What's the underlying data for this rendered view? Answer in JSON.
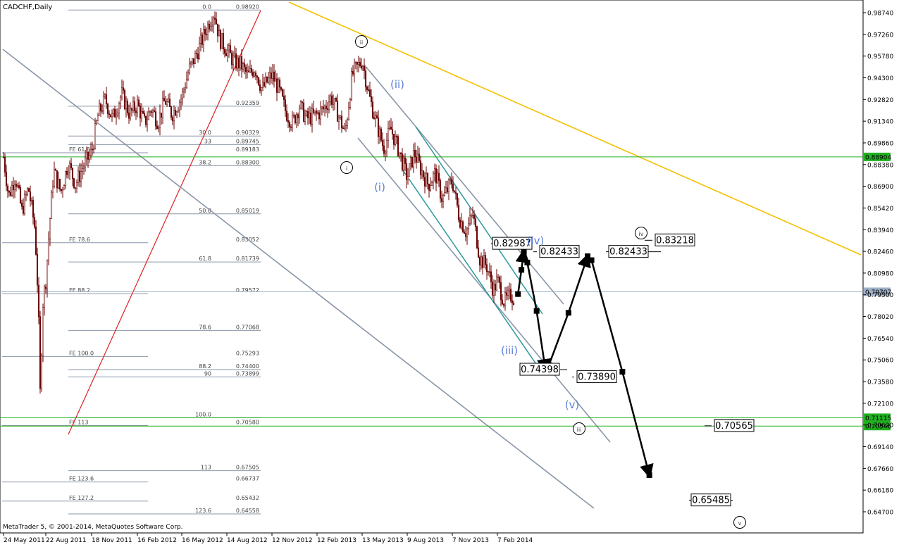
{
  "header": {
    "symbol": "CADCHF,Daily"
  },
  "footer": {
    "copyright": "MetaTrader 5, © 2001-2014, MetaQuotes Software Corp."
  },
  "chart_data": {
    "type": "candlestick",
    "title": "CADCHF,Daily",
    "ylim": [
      0.6442,
      0.9934
    ],
    "y_ticks": [
      "0.98740",
      "0.97260",
      "0.95780",
      "0.94300",
      "0.92820",
      "0.91340",
      "0.89860",
      "0.88380",
      "0.86900",
      "0.85420",
      "0.83940",
      "0.82460",
      "0.80980",
      "0.79500",
      "0.78020",
      "0.76540",
      "0.75060",
      "0.73580",
      "0.72100",
      "0.70620",
      "0.69140",
      "0.67660",
      "0.66180",
      "0.64700"
    ],
    "x_ticks": [
      "24 May 2011",
      "22 Aug 2011",
      "18 Nov 2011",
      "16 Feb 2012",
      "16 May 2012",
      "14 Aug 2012",
      "12 Nov 2012",
      "12 Feb 2013",
      "13 May 2013",
      "9 Aug 2013",
      "7 Nov 2013",
      "7 Feb 2014"
    ],
    "price_tags": [
      {
        "label": "0.88904",
        "value": 0.88904,
        "color": "#20b020"
      },
      {
        "label": "0.79707",
        "value": 0.79707,
        "color": "#9fb0c8"
      },
      {
        "label": "0.71115",
        "value": 0.71115,
        "color": "#20b020"
      },
      {
        "label": "0.70546",
        "value": 0.70546,
        "color": "#20b020"
      }
    ],
    "fib_levels": [
      {
        "left": "",
        "right_a": "0.0",
        "right_b": "0.98920",
        "value": 0.9892,
        "span": "long"
      },
      {
        "left": "",
        "right_a": "",
        "right_b": "0.92359",
        "value": 0.92359,
        "span": "long"
      },
      {
        "left": "",
        "right_a": "30.0",
        "right_b": "0.90329",
        "value": 0.90329,
        "span": "long"
      },
      {
        "left": "",
        "right_a": "33",
        "right_b": "0.89745",
        "value": 0.89745,
        "span": "long"
      },
      {
        "left": "FE 61.8",
        "right_a": "",
        "right_b": "0.89183",
        "value": 0.89183,
        "span": "short"
      },
      {
        "left": "",
        "right_a": "38.2",
        "right_b": "0.88300",
        "value": 0.883,
        "span": "long"
      },
      {
        "left": "",
        "right_a": "50.0",
        "right_b": "0.85019",
        "value": 0.85019,
        "span": "long"
      },
      {
        "left": "FE 78.6",
        "right_a": "",
        "right_b": "0.83052",
        "value": 0.83052,
        "span": "short"
      },
      {
        "left": "",
        "right_a": "61.8",
        "right_b": "0.81739",
        "value": 0.81739,
        "span": "long"
      },
      {
        "left": "FE 88.2",
        "right_a": "",
        "right_b": "0.79572",
        "value": 0.79572,
        "span": "short"
      },
      {
        "left": "",
        "right_a": "78.6",
        "right_b": "0.77068",
        "value": 0.77068,
        "span": "long"
      },
      {
        "left": "FE 100.0",
        "right_a": "",
        "right_b": "0.75293",
        "value": 0.75293,
        "span": "short"
      },
      {
        "left": "",
        "right_a": "88.2",
        "right_b": "0.74400",
        "value": 0.744,
        "span": "long"
      },
      {
        "left": "",
        "right_a": "90",
        "right_b": "0.73899",
        "value": 0.73899,
        "span": "long"
      },
      {
        "left": "",
        "right_a": "100.0",
        "right_b": "",
        "value": 0.71115,
        "span": "long"
      },
      {
        "left": "FE 113",
        "right_a": "",
        "right_b": "0.70580",
        "value": 0.7058,
        "span": "short"
      },
      {
        "left": "",
        "right_a": "113",
        "right_b": "0.67505",
        "value": 0.67505,
        "span": "long"
      },
      {
        "left": "FE 123.6",
        "right_a": "",
        "right_b": "0.66737",
        "value": 0.66737,
        "span": "short"
      },
      {
        "left": "FE 127.2",
        "right_a": "",
        "right_b": "0.65432",
        "value": 0.65432,
        "span": "short"
      },
      {
        "left": "",
        "right_a": "123.6",
        "right_b": "0.64558",
        "value": 0.64558,
        "span": "long"
      }
    ],
    "price_path": [
      [
        "24 May 2011",
        0.889
      ],
      [
        "4 Jun 2011",
        0.862
      ],
      [
        "18 Jun 2011",
        0.876
      ],
      [
        "2 Jul 2011",
        0.852
      ],
      [
        "16 Jul 2011",
        0.868
      ],
      [
        "30 Jul 2011",
        0.84
      ],
      [
        "6 Aug 2011",
        0.79
      ],
      [
        "10 Aug 2011",
        0.728
      ],
      [
        "16 Aug 2011",
        0.79
      ],
      [
        "22 Aug 2011",
        0.805
      ],
      [
        "29 Aug 2011",
        0.842
      ],
      [
        "6 Sep 2011",
        0.88
      ],
      [
        "20 Sep 2011",
        0.865
      ],
      [
        "4 Oct 2011",
        0.885
      ],
      [
        "18 Oct 2011",
        0.87
      ],
      [
        "1 Nov 2011",
        0.882
      ],
      [
        "18 Nov 2011",
        0.892
      ],
      [
        "1 Dec 2011",
        0.918
      ],
      [
        "15 Dec 2011",
        0.928
      ],
      [
        "29 Dec 2011",
        0.915
      ],
      [
        "16 Jan 2012",
        0.932
      ],
      [
        "1 Feb 2012",
        0.918
      ],
      [
        "16 Feb 2012",
        0.925
      ],
      [
        "1 Mar 2012",
        0.912
      ],
      [
        "15 Mar 2012",
        0.922
      ],
      [
        "29 Mar 2012",
        0.913
      ],
      [
        "12 Apr 2012",
        0.928
      ],
      [
        "26 Apr 2012",
        0.918
      ],
      [
        "16 May 2012",
        0.93
      ],
      [
        "30 May 2012",
        0.948
      ],
      [
        "13 Jun 2012",
        0.958
      ],
      [
        "27 Jun 2012",
        0.97
      ],
      [
        "11 Jul 2012",
        0.982
      ],
      [
        "20 Jul 2012",
        0.988
      ],
      [
        "30 Jul 2012",
        0.97
      ],
      [
        "14 Aug 2012",
        0.962
      ],
      [
        "28 Aug 2012",
        0.954
      ],
      [
        "11 Sep 2012",
        0.952
      ],
      [
        "25 Sep 2012",
        0.944
      ],
      [
        "9 Oct 2012",
        0.95
      ],
      [
        "23 Oct 2012",
        0.935
      ],
      [
        "12 Nov 2012",
        0.945
      ],
      [
        "26 Nov 2012",
        0.935
      ],
      [
        "10 Dec 2012",
        0.92
      ],
      [
        "24 Dec 2012",
        0.912
      ],
      [
        "7 Jan 2013",
        0.924
      ],
      [
        "21 Jan 2013",
        0.915
      ],
      [
        "12 Feb 2013",
        0.918
      ],
      [
        "26 Feb 2013",
        0.922
      ],
      [
        "12 Mar 2013",
        0.93
      ],
      [
        "26 Mar 2013",
        0.918
      ],
      [
        "9 Apr 2013",
        0.905
      ],
      [
        "23 Apr 2013",
        0.945
      ],
      [
        "13 May 2013",
        0.955
      ],
      [
        "27 May 2013",
        0.93
      ],
      [
        "10 Jun 2013",
        0.912
      ],
      [
        "24 Jun 2013",
        0.895
      ],
      [
        "8 Jul 2013",
        0.908
      ],
      [
        "22 Jul 2013",
        0.895
      ],
      [
        "9 Aug 2013",
        0.875
      ],
      [
        "23 Aug 2013",
        0.892
      ],
      [
        "6 Sep 2013",
        0.88
      ],
      [
        "20 Sep 2013",
        0.87
      ],
      [
        "4 Oct 2013",
        0.878
      ],
      [
        "18 Oct 2013",
        0.86
      ],
      [
        "7 Nov 2013",
        0.873
      ],
      [
        "21 Nov 2013",
        0.848
      ],
      [
        "5 Dec 2013",
        0.838
      ],
      [
        "19 Dec 2013",
        0.85
      ],
      [
        "2 Jan 2014",
        0.82
      ],
      [
        "16 Jan 2014",
        0.815
      ],
      [
        "30 Jan 2014",
        0.798
      ],
      [
        "7 Feb 2014",
        0.805
      ],
      [
        "21 Feb 2014",
        0.79
      ],
      [
        "7 Mar 2014",
        0.795
      ],
      [
        "14 Mar 2014",
        0.792
      ]
    ],
    "projection": [
      [
        "21 Mar 2014",
        0.7955
      ],
      [
        "28 Mar 2014",
        0.812
      ],
      [
        "2 Apr 2014",
        0.8243
      ],
      [
        "9 Apr 2014",
        0.817
      ],
      [
        "28 Apr 2014",
        0.784
      ],
      [
        "16 May 2014",
        0.7439
      ],
      [
        "23 May 2014",
        0.747
      ],
      [
        "2 Jul 2014",
        0.7827
      ],
      [
        "10 Aug 2014",
        0.8213
      ],
      [
        "18 Aug 2014",
        0.8186
      ],
      [
        "20 Oct 2014",
        0.7425
      ],
      [
        "14 Dec 2014",
        0.672
      ]
    ],
    "value_boxes": [
      "0.82987",
      "0.82433",
      "0.82433",
      "0.83218",
      "0.74398",
      "0.73890",
      "0.70565",
      "0.65485"
    ],
    "wave_labels_blue": [
      "(i)",
      "(ii)",
      "(iii)",
      "(iv)",
      "(v)"
    ],
    "wave_labels_circled": [
      "i",
      "ii",
      "iii",
      "iv",
      "v"
    ],
    "series": [
      {
        "name": "",
        "type": "candles",
        "color": "#6a0000"
      },
      {
        "name": "",
        "type": "projection",
        "color": "#000000"
      }
    ],
    "colors": {
      "candles": "#6a0000",
      "channel": "#8a96a8",
      "inner_channel": "#2a9a9a",
      "trend_yellow": "#f5c000",
      "trend_red": "#e02020",
      "fib": "#8a96a8",
      "green_levels": "#20b020",
      "wave_blue": "#5b7fd6"
    }
  }
}
